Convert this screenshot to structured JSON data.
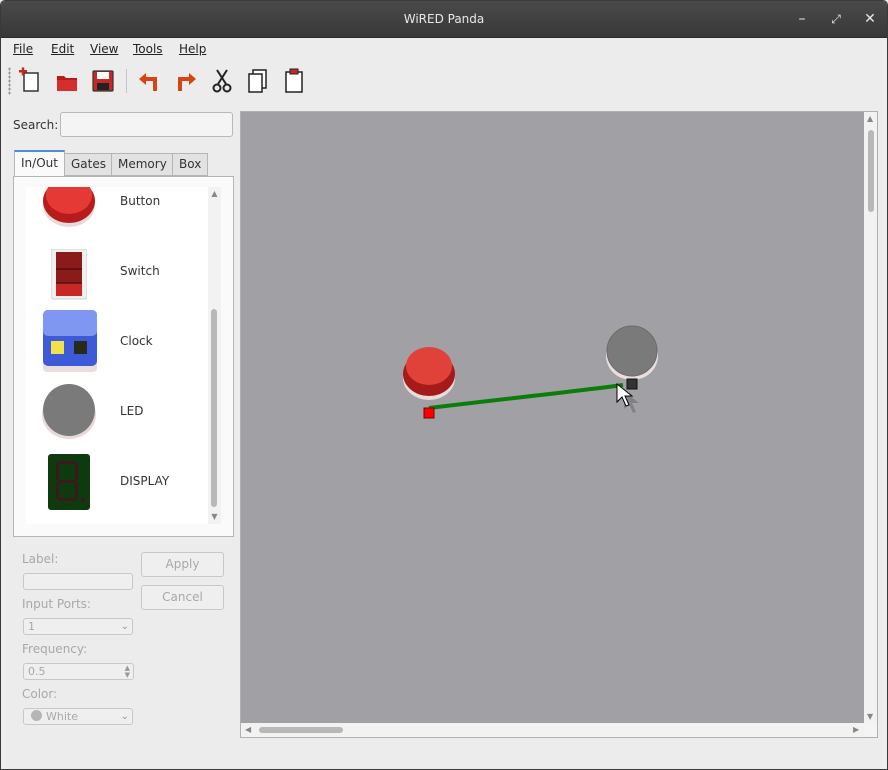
{
  "window": {
    "title": "WiRED Panda"
  },
  "menu": [
    {
      "label": "File"
    },
    {
      "label": "Edit"
    },
    {
      "label": "View"
    },
    {
      "label": "Tools"
    },
    {
      "label": "Help"
    }
  ],
  "toolbar": {
    "icons": [
      "new-file-icon",
      "open-folder-icon",
      "save-icon",
      "undo-icon",
      "redo-icon",
      "cut-icon",
      "copy-icon",
      "paste-icon"
    ]
  },
  "search": {
    "label": "Search:",
    "value": "",
    "placeholder": ""
  },
  "tabs": [
    {
      "label": "In/Out",
      "active": true
    },
    {
      "label": "Gates"
    },
    {
      "label": "Memory"
    },
    {
      "label": "Box"
    }
  ],
  "elements": [
    {
      "label": "Button",
      "icon": "button-icon"
    },
    {
      "label": "Switch",
      "icon": "switch-icon"
    },
    {
      "label": "Clock",
      "icon": "clock-icon"
    },
    {
      "label": "LED",
      "icon": "led-icon"
    },
    {
      "label": "DISPLAY",
      "icon": "display-icon"
    }
  ],
  "properties": {
    "label_label": "Label:",
    "label_value": "",
    "input_ports_label": "Input Ports:",
    "input_ports_value": "1",
    "frequency_label": "Frequency:",
    "frequency_value": "0.5",
    "color_label": "Color:",
    "color_value": "White",
    "apply_label": "Apply",
    "cancel_label": "Cancel"
  },
  "colors": {
    "canvas_bg": "#a1a0a5",
    "wire": "#0a7d0a",
    "button_red": "#d3382c",
    "led_off": "#7a7a7a",
    "output_port": "#ff0000",
    "input_port": "#333333"
  }
}
